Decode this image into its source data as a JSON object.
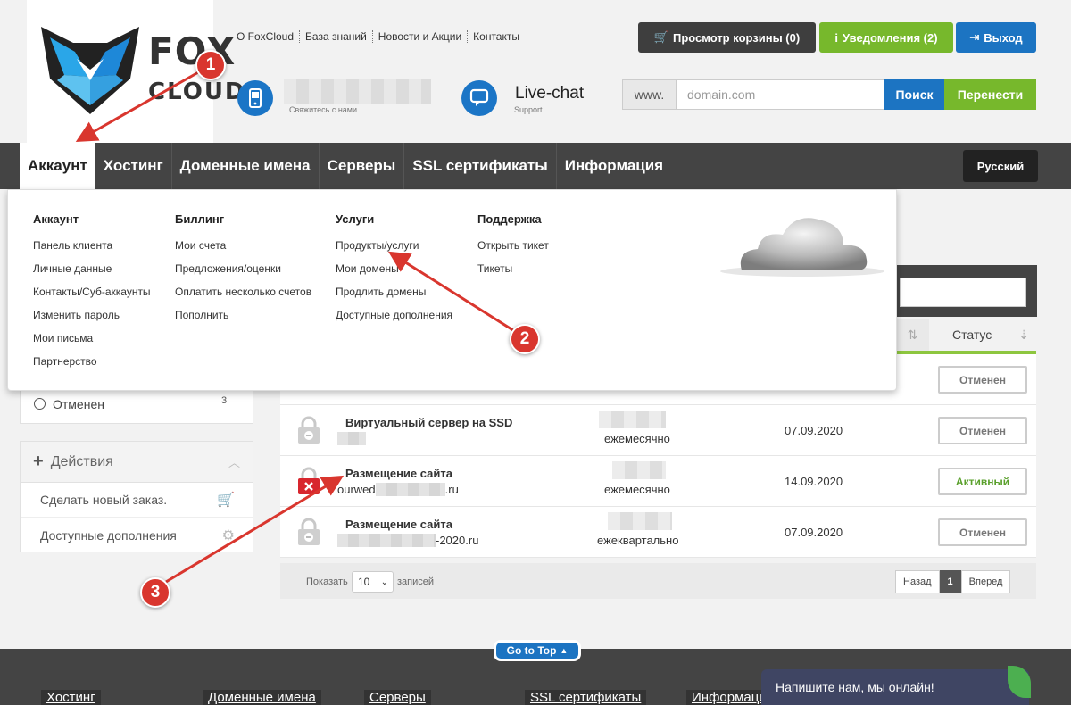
{
  "logo": {
    "line1": "FOX",
    "line2": "CLOUD"
  },
  "top_links": [
    "О FoxCloud",
    "База знаний",
    "Новости и Акции",
    "Контакты"
  ],
  "contact": {
    "phone_caption": "Свяжитесь с нами",
    "chat_title": "Live-chat",
    "chat_caption": "Support"
  },
  "buttons": {
    "cart": "Просмотр корзины (0)",
    "notifications": "Уведомления (2)",
    "logout": "Выход"
  },
  "domain_search": {
    "prefix": "www.",
    "placeholder": "domain.com",
    "search": "Поиск",
    "transfer": "Перенести"
  },
  "nav": {
    "items": [
      "Аккаунт",
      "Хостинг",
      "Доменные имена",
      "Серверы",
      "SSL сертификаты",
      "Информация"
    ],
    "language": "Русский"
  },
  "mega_menu": {
    "columns": [
      {
        "title": "Аккаунт",
        "links": [
          "Панель клиента",
          "Личные данные",
          "Контакты/Суб-аккаунты",
          "Изменить пароль",
          "Мои письма",
          "Партнерство"
        ]
      },
      {
        "title": "Биллинг",
        "links": [
          "Мои счета",
          "Предложения/оценки",
          "Оплатить несколько счетов",
          "Пополнить"
        ]
      },
      {
        "title": "Услуги",
        "links": [
          "Продукты/услуги",
          "Мои домены",
          "Продлить домены",
          "Доступные дополнения"
        ]
      },
      {
        "title": "Поддержка",
        "links": [
          "Открыть тикет",
          "Тикеты"
        ]
      }
    ]
  },
  "table": {
    "status_header": "Статус"
  },
  "sidebar": {
    "status_filter": {
      "label": "Отменен",
      "count": "3"
    },
    "actions": {
      "title": "Действия",
      "items": [
        "Сделать новый заказ.",
        "Доступные дополнения"
      ]
    }
  },
  "services": [
    {
      "status": "Отменен"
    },
    {
      "name": "Виртуальный сервер на SSD",
      "domain_suffix": "",
      "cycle": "ежемесячно",
      "date": "07.09.2020",
      "status": "Отменен"
    },
    {
      "name": "Размещение сайта",
      "domain_prefix": "ourwed",
      "domain_suffix": ".ru",
      "cycle": "ежемесячно",
      "date": "14.09.2020",
      "status": "Активный"
    },
    {
      "name": "Размещение сайта",
      "domain_suffix": "-2020.ru",
      "cycle": "ежеквартально",
      "date": "07.09.2020",
      "status": "Отменен"
    }
  ],
  "pagination": {
    "show": "Показать",
    "length": "10",
    "records": "записей",
    "prev": "Назад",
    "page": "1",
    "next": "Вперед"
  },
  "footer": {
    "goto_top": "Go to Top",
    "links": [
      "Хостинг",
      "Доменные имена",
      "Серверы",
      "SSL сертификаты",
      "Информация"
    ],
    "chat_widget": "Напишите нам, мы онлайн!"
  },
  "annotations": [
    "1",
    "2",
    "3"
  ],
  "colors": {
    "accent_blue": "#1c74c2",
    "accent_green": "#77b82c",
    "nav_dark": "#444444",
    "badge_red": "#d9362e"
  }
}
